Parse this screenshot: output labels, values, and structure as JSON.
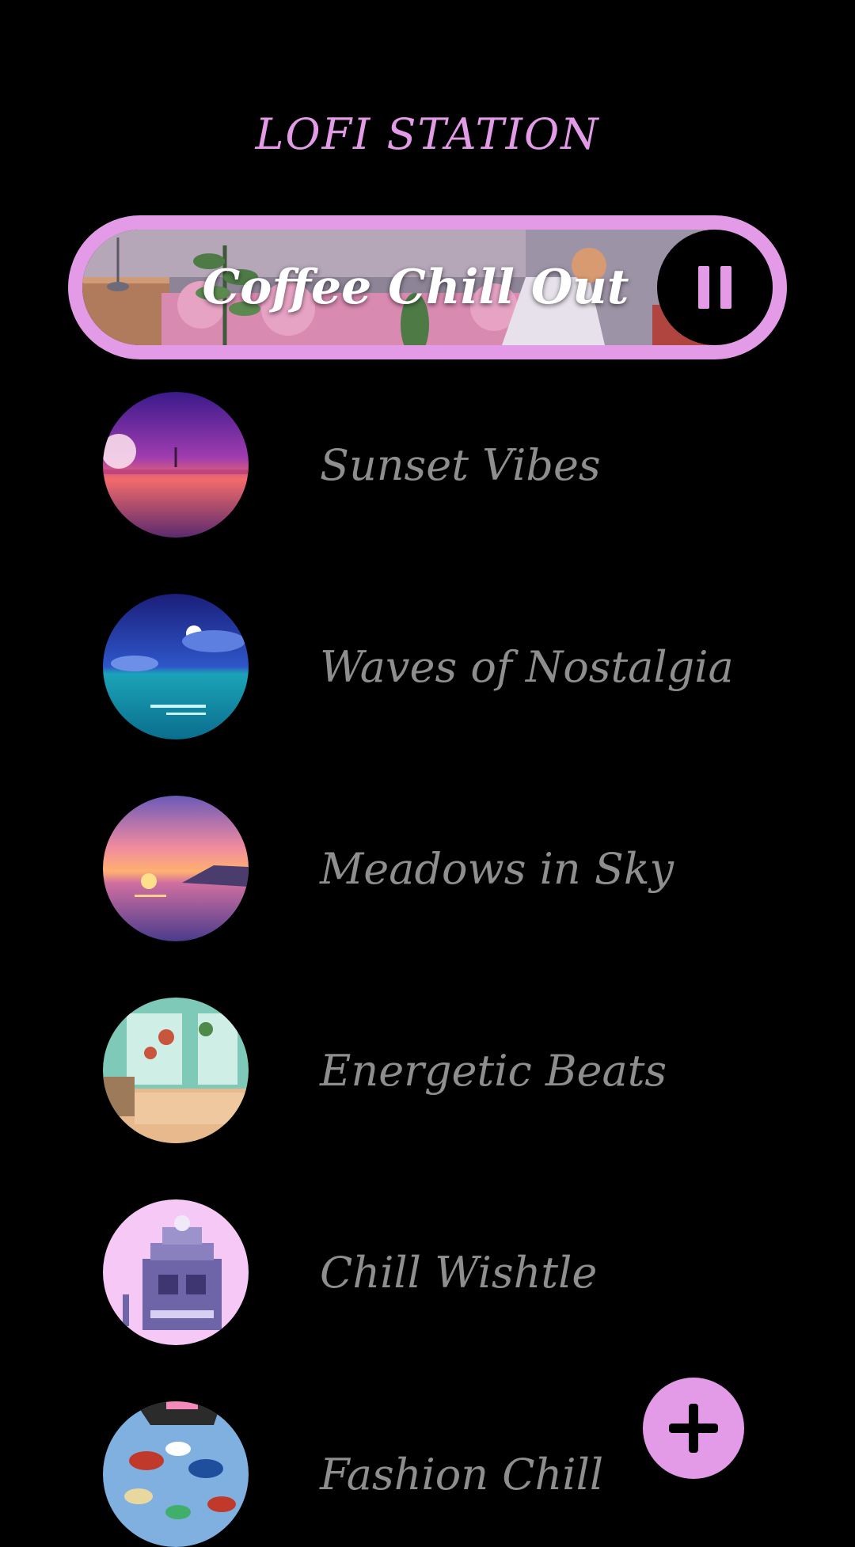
{
  "app": {
    "title": "LOFI STATION"
  },
  "now_playing": {
    "title": "Coffee Chill Out",
    "control_icon": "pause-icon",
    "state": "playing"
  },
  "tracks": [
    {
      "title": "Sunset Vibes",
      "art": "sunset-lake-art"
    },
    {
      "title": "Waves of Nostalgia",
      "art": "night-ocean-art"
    },
    {
      "title": "Meadows in Sky",
      "art": "sea-sunset-art"
    },
    {
      "title": "Energetic Beats",
      "art": "cozy-bedroom-art"
    },
    {
      "title": "Chill Wishtle",
      "art": "pixel-house-art"
    },
    {
      "title": "Fashion Chill",
      "art": "shoes-rain-art"
    }
  ],
  "fab": {
    "icon": "plus-icon"
  },
  "colors": {
    "accent": "#E39BE8",
    "background": "#000000",
    "track_text": "#8E8E8E",
    "now_playing_text": "#FFFFFF"
  }
}
